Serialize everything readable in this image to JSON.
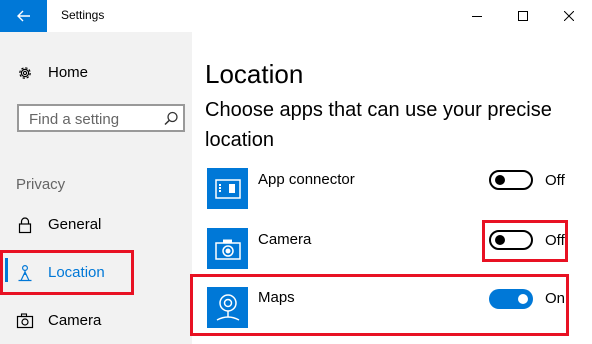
{
  "window": {
    "title": "Settings",
    "back_icon": "arrow-left-icon",
    "minimize_icon": "minimize-icon",
    "maximize_icon": "maximize-icon",
    "close_icon": "close-icon"
  },
  "sidebar": {
    "home_label": "Home",
    "search_placeholder": "Find a setting",
    "section_label": "Privacy",
    "items": [
      {
        "label": "General",
        "icon": "lock-icon",
        "selected": false
      },
      {
        "label": "Location",
        "icon": "location-person-icon",
        "selected": true
      },
      {
        "label": "Camera",
        "icon": "camera-icon",
        "selected": false
      }
    ]
  },
  "main": {
    "title": "Location",
    "subtitle": "Choose apps that can use your precise location",
    "apps": [
      {
        "name": "App connector",
        "icon": "app-connector-icon",
        "state_label": "Off",
        "on": false
      },
      {
        "name": "Camera",
        "icon": "camera-app-icon",
        "state_label": "Off",
        "on": false
      },
      {
        "name": "Maps",
        "icon": "maps-icon",
        "state_label": "On",
        "on": true
      }
    ]
  },
  "colors": {
    "accent": "#0078d7",
    "highlight": "#e81123",
    "sidebar_bg": "#f2f2f2"
  }
}
